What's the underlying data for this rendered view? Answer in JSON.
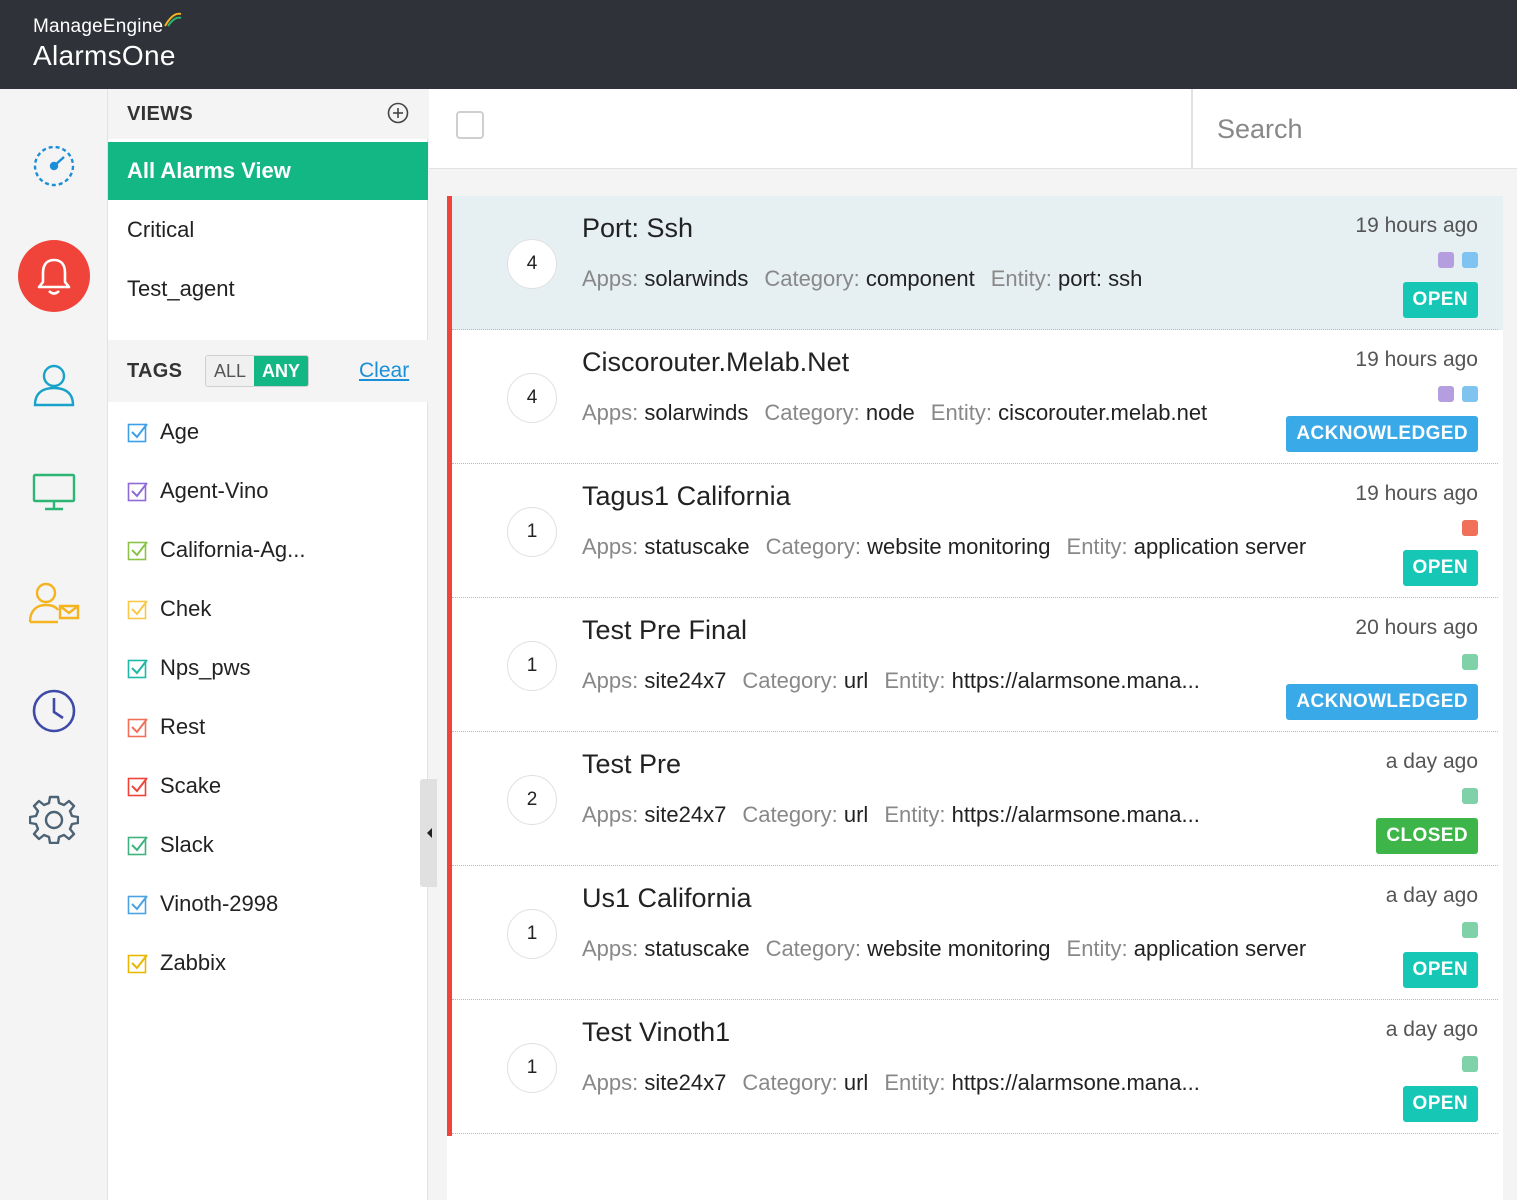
{
  "header": {
    "vendor": "ManageEngine",
    "product": "AlarmsOne"
  },
  "rail": {
    "items": [
      {
        "name": "dashboard-icon",
        "color": "#1a8fd8"
      },
      {
        "name": "alarms-bell-icon",
        "color": "#ffffff",
        "active": true
      },
      {
        "name": "user-icon",
        "color": "#19a2c9"
      },
      {
        "name": "monitor-icon",
        "color": "#2bb673"
      },
      {
        "name": "user-notify-icon",
        "color": "#f5b320"
      },
      {
        "name": "history-clock-icon",
        "color": "#3f4aa8"
      },
      {
        "name": "settings-gear-icon",
        "color": "#4c6375"
      }
    ]
  },
  "views": {
    "title": "VIEWS",
    "items": [
      "All Alarms View",
      "Critical",
      "Test_agent"
    ]
  },
  "tags": {
    "title": "TAGS",
    "toggle_all": "ALL",
    "toggle_any": "ANY",
    "clear": "Clear",
    "items": [
      {
        "label": "Age",
        "color": "#3ba0e8"
      },
      {
        "label": "Agent-Vino",
        "color": "#8e6bd6"
      },
      {
        "label": "California-Ag...",
        "color": "#8bc34a"
      },
      {
        "label": "Chek",
        "color": "#f7c948"
      },
      {
        "label": "Nps_pws",
        "color": "#1fb7a6"
      },
      {
        "label": "Rest",
        "color": "#f0705a"
      },
      {
        "label": "Scake",
        "color": "#f0443a"
      },
      {
        "label": "Slack",
        "color": "#3fb27f"
      },
      {
        "label": "Vinoth-2998",
        "color": "#4aa3df"
      },
      {
        "label": "Zabbix",
        "color": "#e6b800"
      }
    ]
  },
  "search": {
    "placeholder": "Search"
  },
  "labels": {
    "apps": "Apps:",
    "category": "Category:",
    "entity": "Entity:"
  },
  "colors": {
    "open": "#17c7b5",
    "acknowledged": "#3aa9e8",
    "closed": "#3db549",
    "critical": "#f0443a",
    "accent": "#13b783"
  },
  "alarms": [
    {
      "count": "4",
      "title": "Port: Ssh",
      "apps": "solarwinds",
      "category": "component",
      "entity": "port: ssh",
      "time": "19 hours ago",
      "tag_colors": [
        "#b49ee0",
        "#7fc4f0"
      ],
      "status": "OPEN"
    },
    {
      "count": "4",
      "title": "Ciscorouter.Melab.Net",
      "apps": "solarwinds",
      "category": "node",
      "entity": "ciscorouter.melab.net",
      "time": "19 hours ago",
      "tag_colors": [
        "#b49ee0",
        "#7fc4f0"
      ],
      "status": "ACKNOWLEDGED"
    },
    {
      "count": "1",
      "title": "Tagus1 California",
      "apps": "statuscake",
      "category": "website monitoring",
      "entity": "application server",
      "time": "19 hours ago",
      "tag_colors": [
        "#f0705a"
      ],
      "status": "OPEN"
    },
    {
      "count": "1",
      "title": "Test Pre Final",
      "apps": "site24x7",
      "category": "url",
      "entity": "https://alarmsone.mana...",
      "time": "20 hours ago",
      "tag_colors": [
        "#7fd1a8"
      ],
      "status": "ACKNOWLEDGED"
    },
    {
      "count": "2",
      "title": "Test Pre",
      "apps": "site24x7",
      "category": "url",
      "entity": "https://alarmsone.mana...",
      "time": "a day ago",
      "tag_colors": [
        "#7fd1a8"
      ],
      "status": "CLOSED"
    },
    {
      "count": "1",
      "title": "Us1 California",
      "apps": "statuscake",
      "category": "website monitoring",
      "entity": "application server",
      "time": "a day ago",
      "tag_colors": [
        "#7fd1a8"
      ],
      "status": "OPEN"
    },
    {
      "count": "1",
      "title": "Test Vinoth1",
      "apps": "site24x7",
      "category": "url",
      "entity": "https://alarmsone.mana...",
      "time": "a day ago",
      "tag_colors": [
        "#7fd1a8"
      ],
      "status": "OPEN"
    }
  ]
}
